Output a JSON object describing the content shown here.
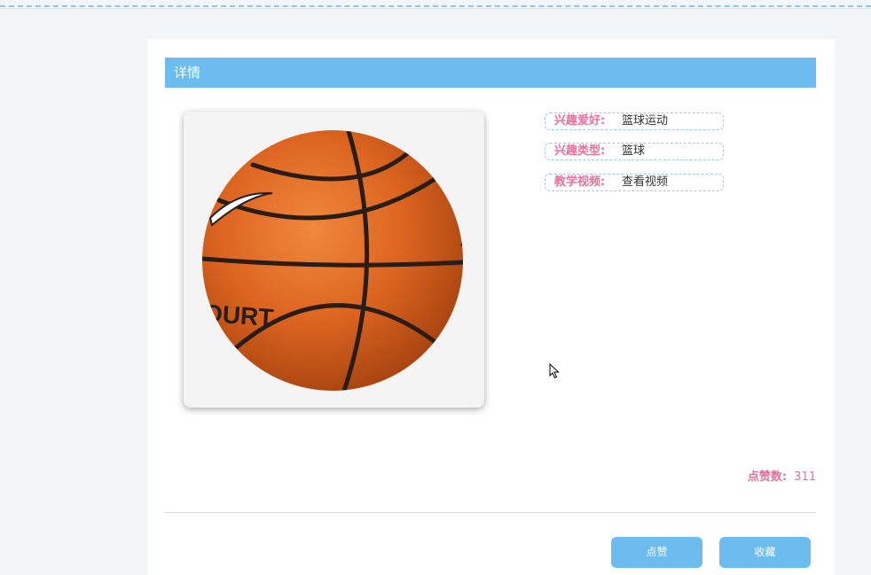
{
  "header": {
    "title": "详情"
  },
  "image": {
    "alt_icon": "basketball-image",
    "print_text": "OURT"
  },
  "fields": [
    {
      "label": "兴趣爱好:",
      "value": "篮球运动"
    },
    {
      "label": "兴趣类型:",
      "value": "篮球"
    },
    {
      "label": "教学视频:",
      "value": "查看视频"
    }
  ],
  "likes": {
    "label": "点赞数:",
    "value": "311"
  },
  "actions": {
    "like_label": "点赞",
    "favorite_label": "收藏"
  },
  "colors": {
    "accent": "#6cbcf0",
    "label_pink": "#e8709a",
    "background": "#f3f6f8"
  }
}
